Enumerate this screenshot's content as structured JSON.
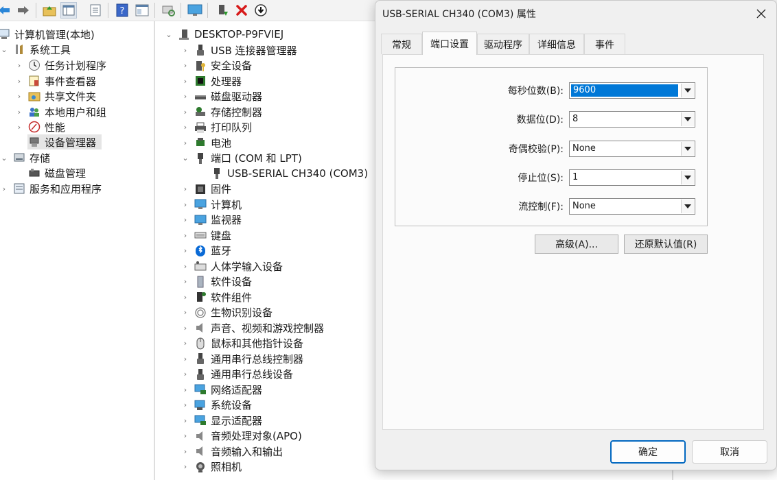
{
  "toolbar": {
    "icons": [
      "back-arrow-icon",
      "forward-arrow-icon",
      "up-folder-icon",
      "show-hide-tree-icon",
      "properties-icon",
      "help-icon",
      "view-icon",
      "scan-icon",
      "monitor-icon",
      "enable-device-icon",
      "uninstall-icon",
      "update-driver-icon"
    ]
  },
  "left_tree": {
    "root": "计算机管理(本地)",
    "system_tools": "系统工具",
    "task_scheduler": "任务计划程序",
    "event_viewer": "事件查看器",
    "shared_folders": "共享文件夹",
    "local_users": "本地用户和组",
    "performance": "性能",
    "device_manager": "设备管理器",
    "storage": "存储",
    "disk_management": "磁盘管理",
    "services_apps": "服务和应用程序"
  },
  "device_tree": {
    "computer": "DESKTOP-P9FVIEJ",
    "categories": [
      {
        "label": "USB 连接器管理器",
        "icon": "usb-icon"
      },
      {
        "label": "安全设备",
        "icon": "security-icon"
      },
      {
        "label": "处理器",
        "icon": "cpu-icon"
      },
      {
        "label": "磁盘驱动器",
        "icon": "disk-icon"
      },
      {
        "label": "存储控制器",
        "icon": "storage-controller-icon"
      },
      {
        "label": "打印队列",
        "icon": "printer-icon"
      },
      {
        "label": "电池",
        "icon": "battery-icon"
      },
      {
        "label": "端口 (COM 和 LPT)",
        "icon": "port-icon"
      },
      {
        "label": "USB-SERIAL CH340 (COM3)",
        "icon": "port-icon"
      },
      {
        "label": "固件",
        "icon": "firmware-icon"
      },
      {
        "label": "计算机",
        "icon": "computer-icon"
      },
      {
        "label": "监视器",
        "icon": "monitor-icon"
      },
      {
        "label": "键盘",
        "icon": "keyboard-icon"
      },
      {
        "label": "蓝牙",
        "icon": "bluetooth-icon"
      },
      {
        "label": "人体学输入设备",
        "icon": "hid-icon"
      },
      {
        "label": "软件设备",
        "icon": "software-device-icon"
      },
      {
        "label": "软件组件",
        "icon": "software-component-icon"
      },
      {
        "label": "生物识别设备",
        "icon": "fingerprint-icon"
      },
      {
        "label": "声音、视频和游戏控制器",
        "icon": "speaker-icon"
      },
      {
        "label": "鼠标和其他指针设备",
        "icon": "mouse-icon"
      },
      {
        "label": "通用串行总线控制器",
        "icon": "usb-icon"
      },
      {
        "label": "通用串行总线设备",
        "icon": "usb-icon"
      },
      {
        "label": "网络适配器",
        "icon": "network-icon"
      },
      {
        "label": "系统设备",
        "icon": "system-device-icon"
      },
      {
        "label": "显示适配器",
        "icon": "display-adapter-icon"
      },
      {
        "label": "音频处理对象(APO)",
        "icon": "speaker-icon"
      },
      {
        "label": "音频输入和输出",
        "icon": "speaker-icon"
      },
      {
        "label": "照相机",
        "icon": "camera-icon"
      }
    ]
  },
  "dialog": {
    "title": "USB-SERIAL CH340 (COM3) 属性",
    "tabs": [
      "常规",
      "端口设置",
      "驱动程序",
      "详细信息",
      "事件"
    ],
    "active_tab": "端口设置",
    "fields": {
      "baud_label": "每秒位数(B):",
      "baud_value": "9600",
      "data_bits_label": "数据位(D):",
      "data_bits_value": "8",
      "parity_label": "奇偶校验(P):",
      "parity_value": "None",
      "stop_bits_label": "停止位(S):",
      "stop_bits_value": "1",
      "flow_label": "流控制(F):",
      "flow_value": "None"
    },
    "advanced_button": "高级(A)...",
    "restore_button": "还原默认值(R)",
    "ok_button": "确定",
    "cancel_button": "取消"
  }
}
